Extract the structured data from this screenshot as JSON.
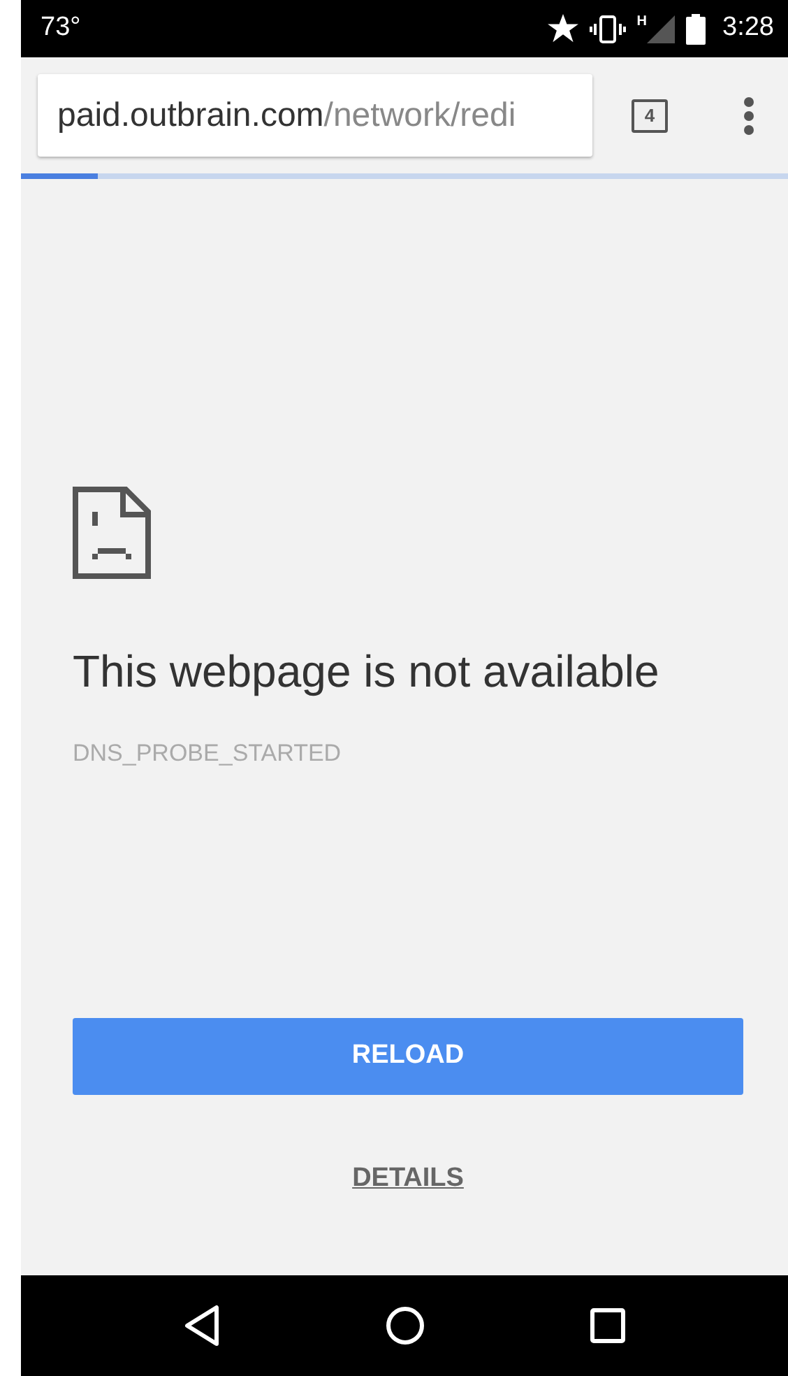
{
  "status_bar": {
    "temperature": "73°",
    "signal_label": "H",
    "time": "3:28"
  },
  "toolbar": {
    "url_host": "paid.outbrain.com",
    "url_path": "/network/redi",
    "tab_count": "4"
  },
  "progress": {
    "level": 0.1
  },
  "error": {
    "title": "This webpage is not available",
    "code": "DNS_PROBE_STARTED"
  },
  "buttons": [
    {
      "kind": "primary",
      "label": "RELOAD"
    },
    {
      "kind": "link",
      "label": "DETAILS"
    }
  ]
}
